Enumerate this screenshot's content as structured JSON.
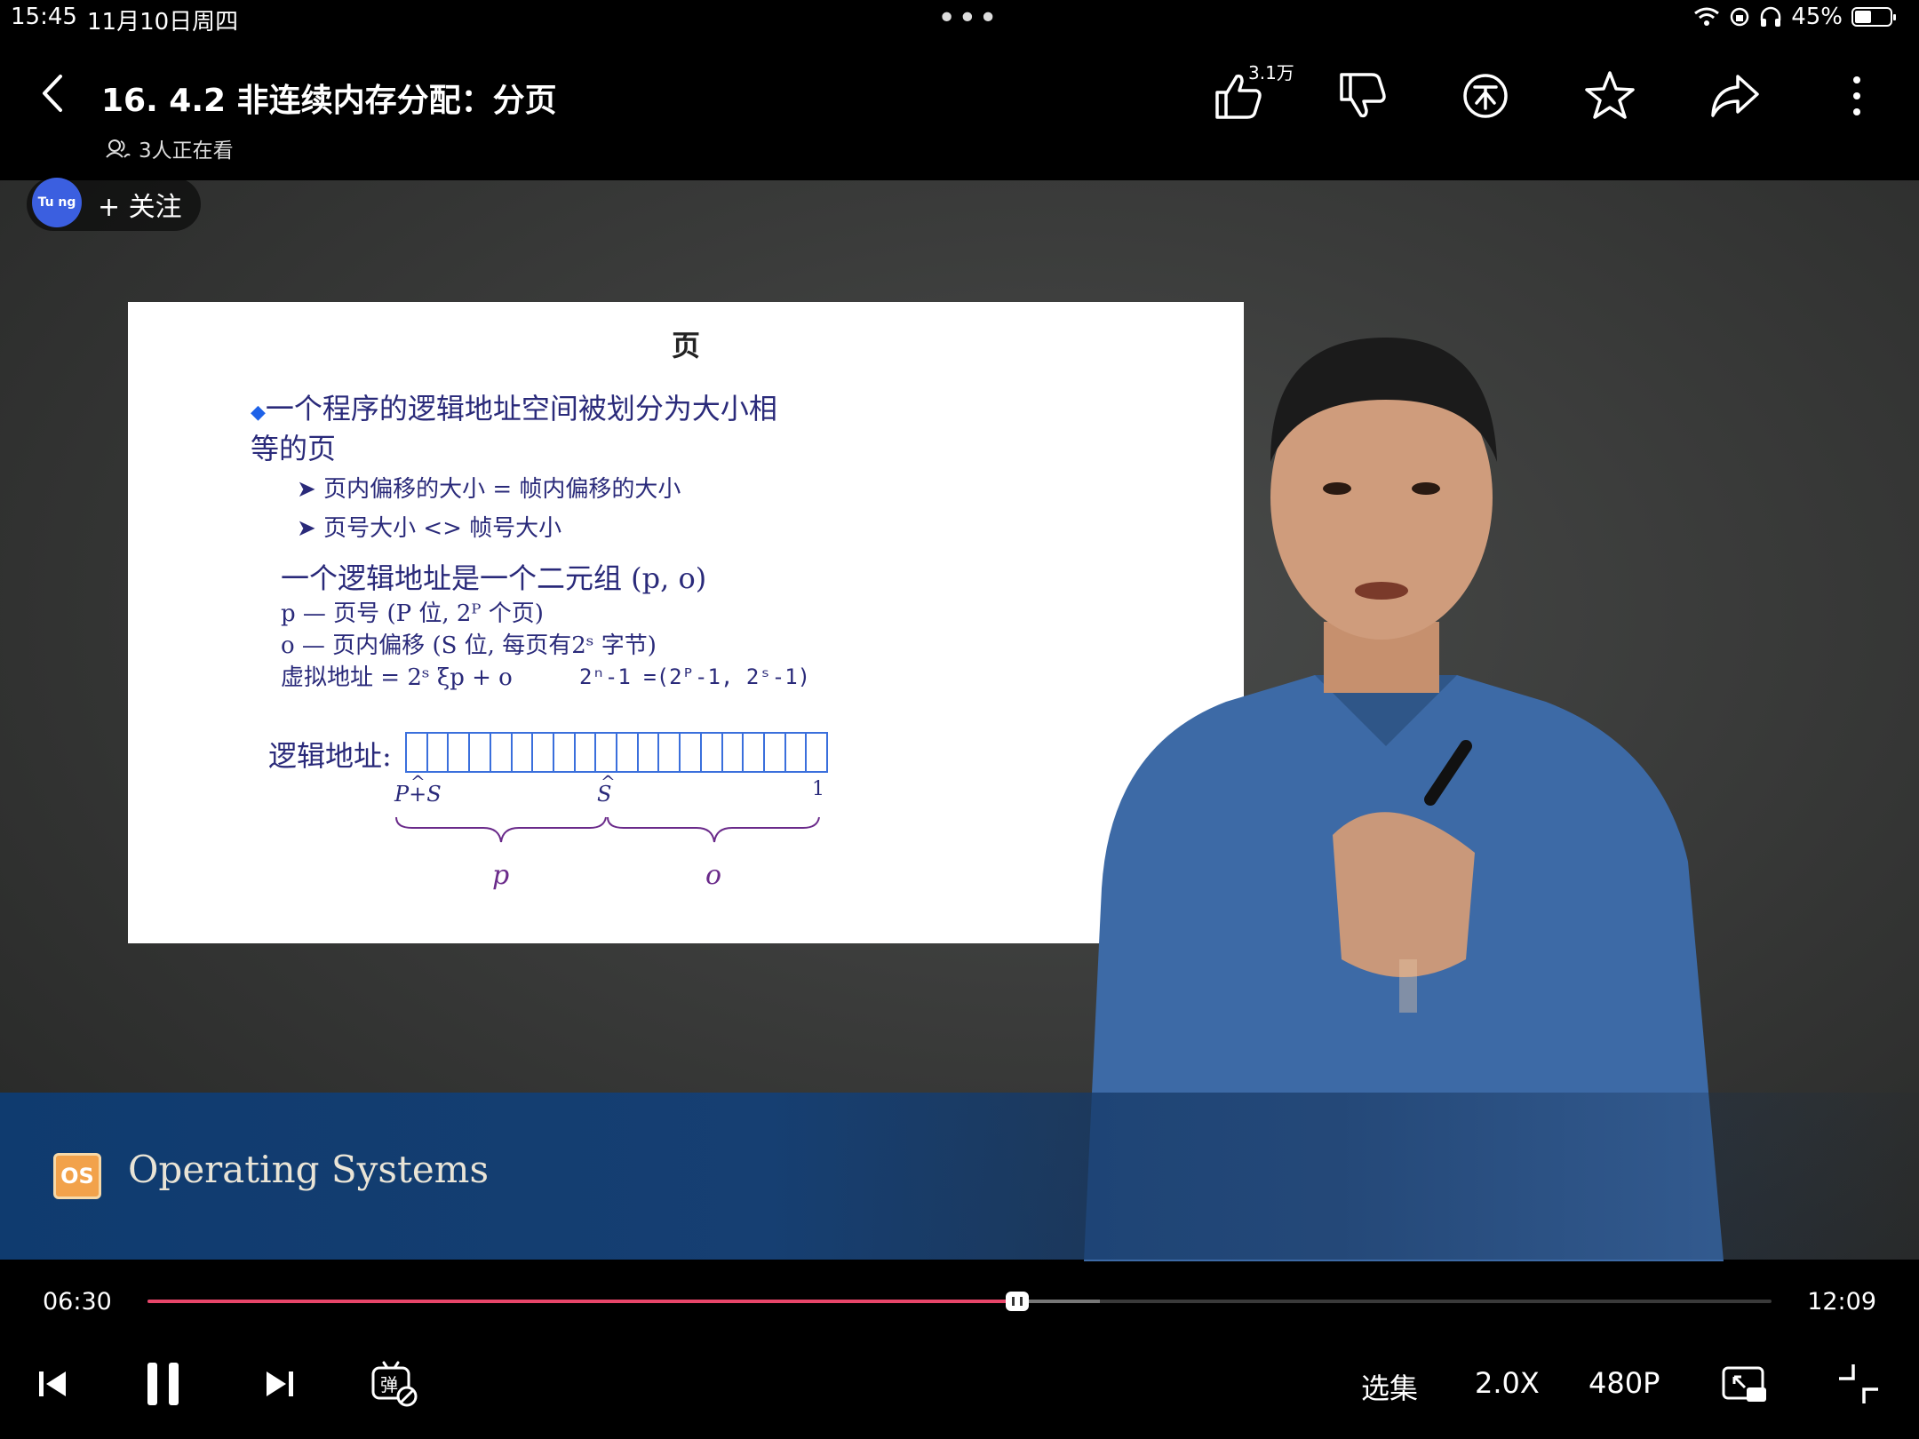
{
  "status_bar": {
    "time": "15:45",
    "date": "11月10日周四",
    "dots": "•••",
    "battery": "45%"
  },
  "header": {
    "title": "16. 4.2 非连续内存分配：分页",
    "viewers": "3人正在看",
    "like_count": "3.1万"
  },
  "channel": {
    "avatar_text": "Tu ng",
    "follow_label": "+ 关注"
  },
  "slide": {
    "title": "页",
    "bullet_line1": "一个程序的逻辑地址空间被划分为大小相",
    "bullet_line2": "等的页",
    "sub1": "页内偏移的大小 = 帧内偏移的大小",
    "sub2": "页号大小 <> 帧号大小",
    "tuple_line": "一个逻辑地址是一个二元组 (p, o)",
    "p_line": "p  — 页号 (P 位, 2ᴾ 个页)",
    "o_line": "o  — 页内偏移 (S 位, 每页有2ˢ 字节)",
    "va_line": "虚拟地址 = 2ˢ ξp + o",
    "formula": "2ⁿ-1 =(2ᴾ-1, 2ˢ-1)",
    "logical_address_label": "逻辑地址:",
    "mark_ps": "P+S",
    "mark_s": "S",
    "mark_1": "1",
    "brace_p": "p",
    "brace_o": "o"
  },
  "banner": {
    "logo_text": "OS",
    "text": "Operating Systems"
  },
  "player": {
    "current_time": "06:30",
    "total_time": "12:09",
    "progress": 0.535,
    "episodes_label": "选集",
    "speed_label": "2.0X",
    "quality_label": "480P"
  },
  "colors": {
    "progress": "#e8466a",
    "avatar": "#3b5fe0",
    "slide_text": "#2a2a7a"
  }
}
